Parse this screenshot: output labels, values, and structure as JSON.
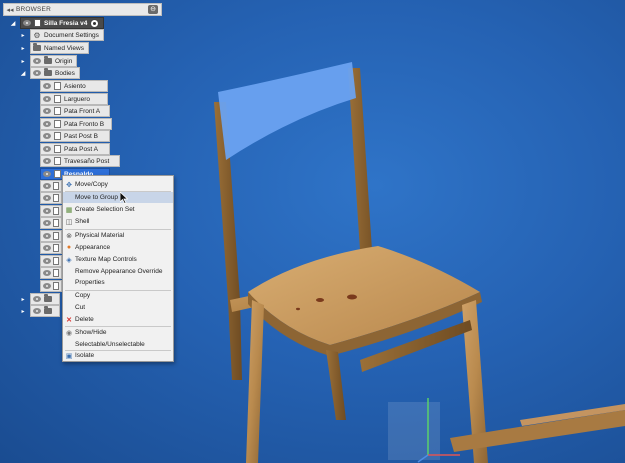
{
  "browser": {
    "collapse_glyph": "◂◂",
    "title": "BROWSER",
    "pin_glyph": "⊖"
  },
  "tree": {
    "root_label": "Silla Fresia v4",
    "items": [
      {
        "label": "Document Settings"
      },
      {
        "label": "Named Views"
      },
      {
        "label": "Origin"
      },
      {
        "label": "Bodies"
      }
    ],
    "bodies": [
      {
        "label": "Asiento"
      },
      {
        "label": "Larguero"
      },
      {
        "label": "Pata Front A"
      },
      {
        "label": "Pata Fronto B"
      },
      {
        "label": "Past Post B"
      },
      {
        "label": "Pata Post A"
      },
      {
        "label": "Travesaño Post"
      },
      {
        "label": "Respaldo"
      }
    ]
  },
  "context_menu": {
    "items": [
      {
        "label": "Move/Copy",
        "icon": "move-icon"
      },
      {
        "label": "Move to Group",
        "icon": "none",
        "highlighted": true
      },
      {
        "label": "Create Selection Set",
        "icon": "selection-set-icon"
      },
      {
        "label": "Shell",
        "icon": "shell-icon"
      },
      {
        "label": "Physical Material",
        "icon": "material-icon"
      },
      {
        "label": "Appearance",
        "icon": "appearance-icon"
      },
      {
        "label": "Texture Map Controls",
        "icon": "texture-icon"
      },
      {
        "label": "Remove Appearance Override",
        "icon": "none"
      },
      {
        "label": "Properties",
        "icon": "none"
      },
      {
        "label": "Copy",
        "icon": "none"
      },
      {
        "label": "Cut",
        "icon": "none"
      },
      {
        "label": "Delete",
        "icon": "delete-x-icon"
      },
      {
        "label": "Show/Hide",
        "icon": "eye-icon"
      },
      {
        "label": "Selectable/Unselectable",
        "icon": "none"
      },
      {
        "label": "Isolate",
        "icon": "isolate-icon"
      }
    ]
  },
  "colors": {
    "viewport_bg": "#2562b3",
    "selected_body": "#2e6fd8",
    "highlight_face": "#6aa2f0",
    "wood": "#b98a4e",
    "delete_red": "#d9302c"
  }
}
